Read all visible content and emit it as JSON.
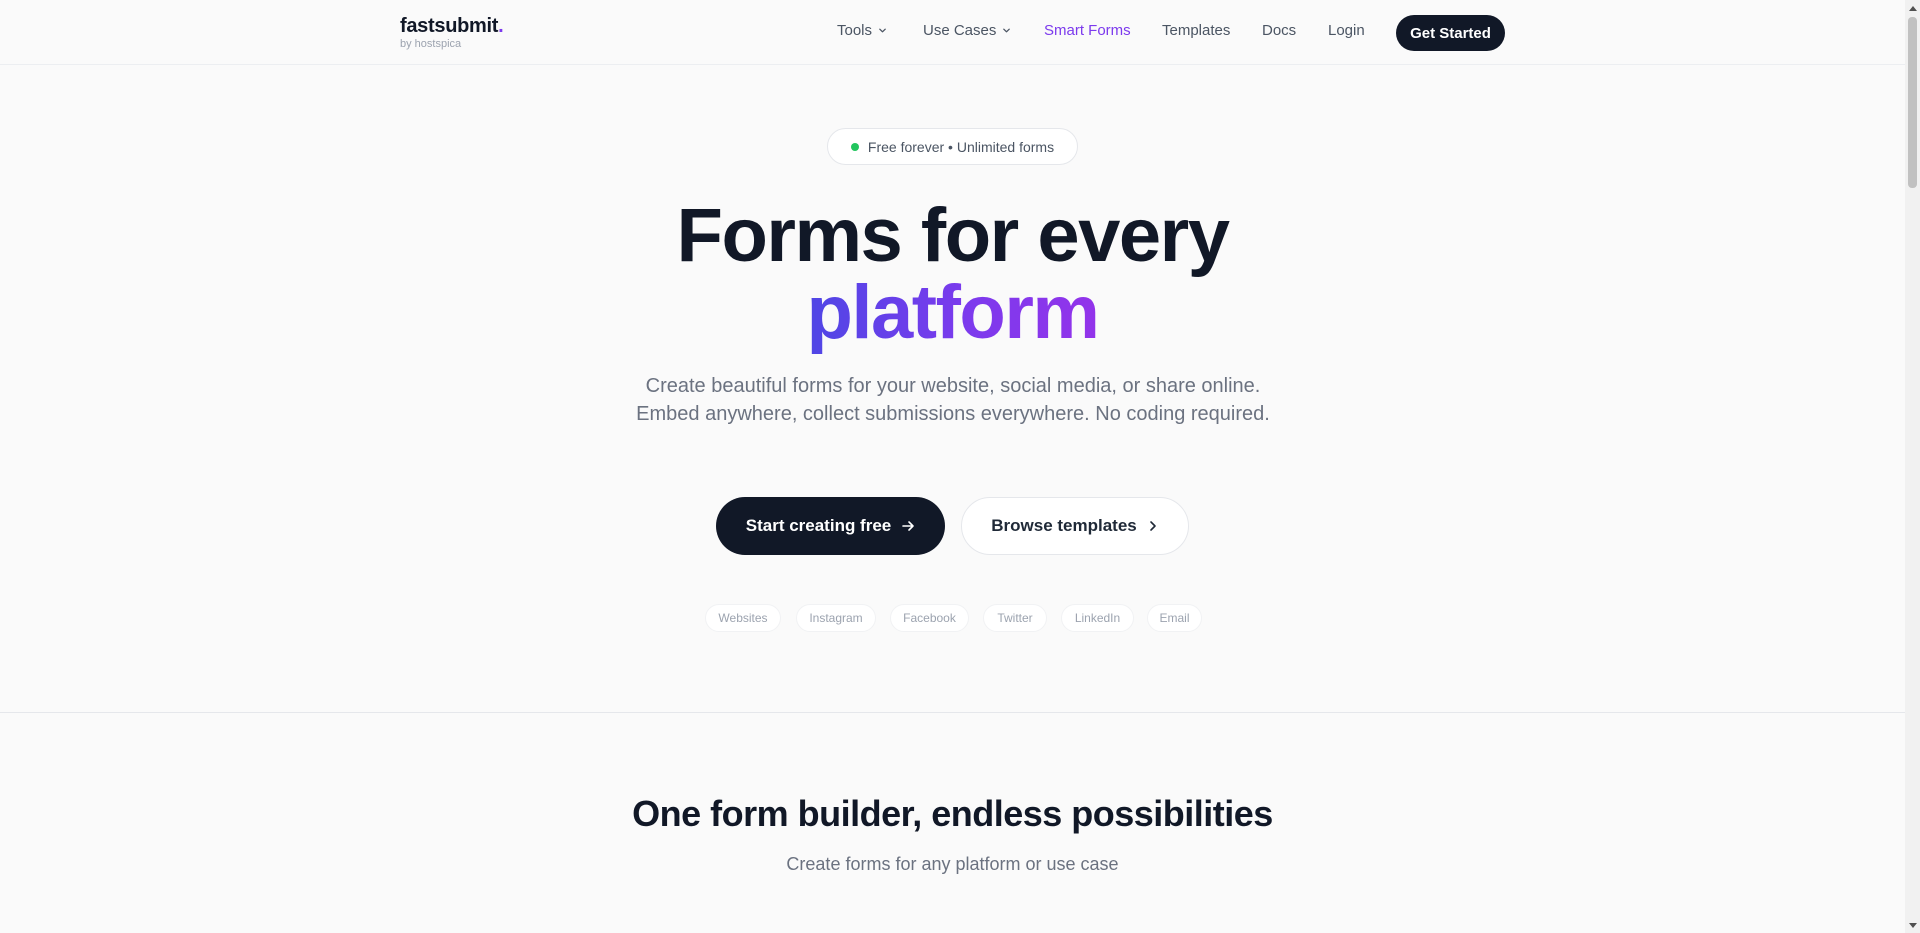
{
  "header": {
    "logo_main": "fastsubmit",
    "logo_dot": ".",
    "logo_sub": "by hostspica",
    "nav": [
      {
        "label": "Tools",
        "dropdown": true
      },
      {
        "label": "Use Cases",
        "dropdown": true
      },
      {
        "label": "Smart Forms",
        "active": true
      },
      {
        "label": "Templates"
      },
      {
        "label": "Docs"
      },
      {
        "label": "Login"
      }
    ],
    "cta_label": "Get Started"
  },
  "hero": {
    "badge_text": "Free forever • Unlimited forms",
    "title_line1": "Forms for every",
    "title_line2": "platform",
    "subtitle": "Create beautiful forms for your website, social media, or share online. Embed anywhere, collect submissions everywhere. No coding required.",
    "primary_button": "Start creating free",
    "secondary_button": "Browse templates",
    "platforms": [
      "Websites",
      "Instagram",
      "Facebook",
      "Twitter",
      "LinkedIn",
      "Email"
    ]
  },
  "section": {
    "title": "One form builder, endless possibilities",
    "subtitle": "Create forms for any platform or use case"
  },
  "colors": {
    "accent": "#7c3aed",
    "dark": "#111827",
    "status_dot": "#22c55e"
  }
}
